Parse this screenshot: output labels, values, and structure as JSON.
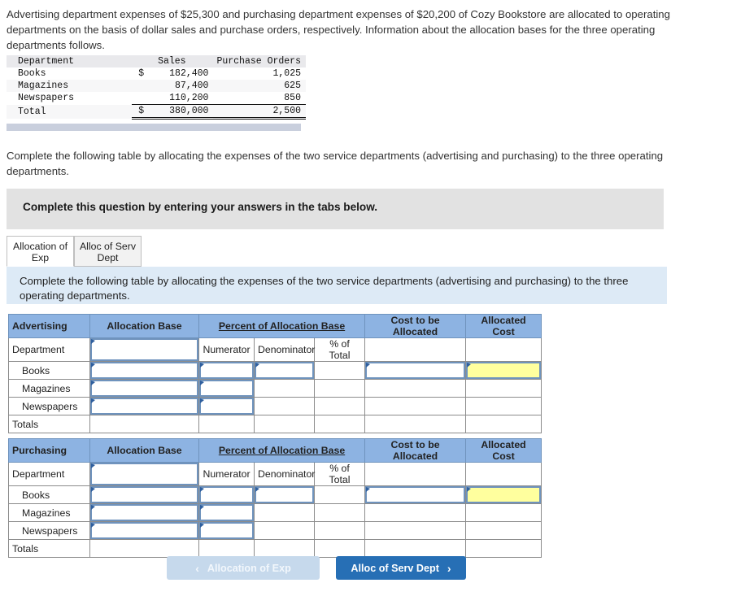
{
  "intro_text": "Advertising department expenses of $25,300 and purchasing department expenses of $20,200 of Cozy Bookstore are allocated to operating departments on the basis of dollar sales and purchase orders, respectively. Information about the allocation bases for the three operating departments follows.",
  "base_table": {
    "headers": [
      "Department",
      "Sales",
      "Purchase Orders"
    ],
    "rows": [
      {
        "department": "Books",
        "sales_symbol": "$",
        "sales": "182,400",
        "purchase_orders": "1,025"
      },
      {
        "department": "Magazines",
        "sales_symbol": "",
        "sales": "87,400",
        "purchase_orders": "625"
      },
      {
        "department": "Newspapers",
        "sales_symbol": "",
        "sales": "110,200",
        "purchase_orders": "850"
      }
    ],
    "total": {
      "department": "Total",
      "sales_symbol": "$",
      "sales": "380,000",
      "purchase_orders": "2,500"
    }
  },
  "paragraph_2": "Complete the following table by allocating the expenses of the two service departments (advertising and purchasing) to the three operating departments.",
  "gray_banner_text": "Complete this question by entering your answers in the tabs below.",
  "tabs": [
    {
      "label": "Allocation of Exp",
      "active": true
    },
    {
      "label": "Alloc of Serv Dept",
      "active": false
    }
  ],
  "blue_band_text": "Complete the following table by allocating the expenses of the two service departments (advertising and purchasing) to the three operating departments.",
  "grids": [
    {
      "title": "Advertising",
      "headers": {
        "allocation_base": "Allocation Base",
        "percent_of_allocation_base": "Percent of Allocation Base",
        "cost_to_be_allocated": "Cost to be Allocated",
        "allocated_cost": "Allocated Cost"
      },
      "sub_headers": {
        "department": "Department",
        "numerator": "Numerator",
        "denominator": "Denominator",
        "percent_of_total": "% of Total"
      },
      "rows": [
        "Books",
        "Magazines",
        "Newspapers"
      ],
      "totals_label": "Totals"
    },
    {
      "title": "Purchasing",
      "headers": {
        "allocation_base": "Allocation Base",
        "percent_of_allocation_base": "Percent of Allocation Base",
        "cost_to_be_allocated": "Cost to be Allocated",
        "allocated_cost": "Allocated Cost"
      },
      "sub_headers": {
        "department": "Department",
        "numerator": "Numerator",
        "denominator": "Denominator",
        "percent_of_total": "% of Total"
      },
      "rows": [
        "Books",
        "Magazines",
        "Newspapers"
      ],
      "totals_label": "Totals"
    }
  ],
  "nav": {
    "prev_label": "Allocation of Exp",
    "prev_chevron": "‹",
    "next_label": "Alloc of Serv Dept",
    "next_chevron": "›"
  },
  "colors": {
    "header_blue": "#8db3e2",
    "input_border_blue": "#6f93bd",
    "answer_yellow": "#ffff9e",
    "band_blue": "#ddeaf6",
    "banner_gray": "#e2e2e2",
    "button_blue": "#276fb5",
    "button_disabled": "#c6d9ec"
  }
}
